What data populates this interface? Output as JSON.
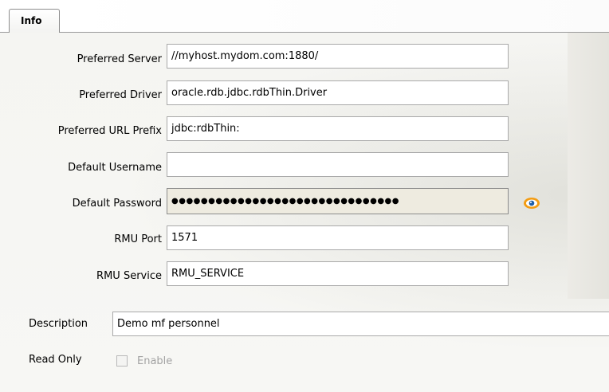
{
  "tabs": [
    {
      "label": "Info"
    }
  ],
  "form": {
    "preferred_server": {
      "label": "Preferred Server",
      "value": "//myhost.mydom.com:1880/"
    },
    "preferred_driver": {
      "label": "Preferred Driver",
      "value": "oracle.rdb.jdbc.rdbThin.Driver"
    },
    "preferred_url_prefix": {
      "label": "Preferred URL Prefix",
      "value": "jdbc:rdbThin:"
    },
    "default_username": {
      "label": "Default Username",
      "value": ""
    },
    "default_password": {
      "label": "Default Password",
      "value": "●●●●●●●●●●●●●●●●●●●●●●●●●●●●●●●"
    },
    "rmu_port": {
      "label": "RMU Port",
      "value": "1571"
    },
    "rmu_service": {
      "label": "RMU Service",
      "value": "RMU_SERVICE"
    },
    "description": {
      "label": "Description",
      "value": "Demo mf personnel"
    },
    "read_only": {
      "label": "Read Only",
      "checkbox_label": "Enable",
      "checked": false,
      "enabled": false
    }
  },
  "icons": {
    "show_password": "eye-icon"
  },
  "colors": {
    "accent_eye": "#f39c12",
    "eye_pupil": "#1f5fa8"
  }
}
